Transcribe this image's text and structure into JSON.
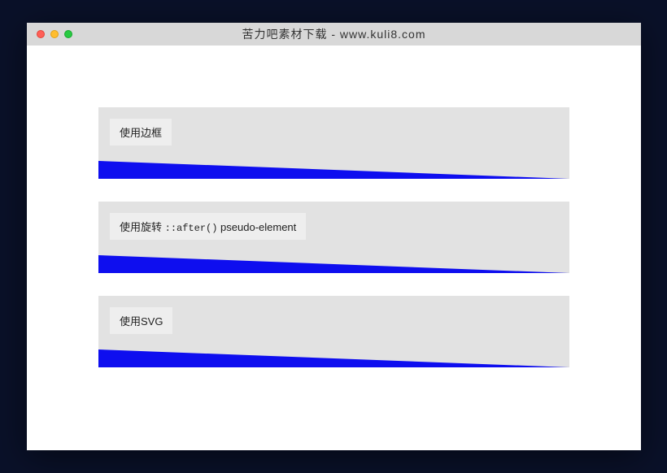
{
  "window": {
    "title": "苦力吧素材下载 - www.kuli8.com"
  },
  "sections": {
    "border": {
      "label": "使用边框"
    },
    "rotate": {
      "label_prefix": "使用旋转 ",
      "label_code": "::after()",
      "label_suffix": " pseudo-element"
    },
    "svg": {
      "label": "使用SVG"
    }
  },
  "colors": {
    "accent": "#0e0eef"
  }
}
